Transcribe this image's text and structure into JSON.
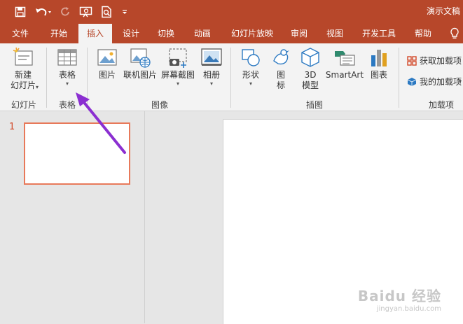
{
  "titlebar": {
    "title": "演示文稿",
    "qat": [
      "save-icon",
      "undo-icon",
      "redo-icon",
      "slideshow-from-start-icon",
      "print-preview-icon",
      "customize-qat-icon"
    ]
  },
  "tabs": [
    {
      "label": "文件",
      "active": false
    },
    {
      "label": "开始",
      "active": false
    },
    {
      "label": "插入",
      "active": true
    },
    {
      "label": "设计",
      "active": false
    },
    {
      "label": "切换",
      "active": false
    },
    {
      "label": "动画",
      "active": false
    },
    {
      "label": "幻灯片放映",
      "active": false
    },
    {
      "label": "审阅",
      "active": false
    },
    {
      "label": "视图",
      "active": false
    },
    {
      "label": "开发工具",
      "active": false
    },
    {
      "label": "帮助",
      "active": false
    }
  ],
  "ribbon": {
    "groups": {
      "slides": "幻灯片",
      "tables": "表格",
      "images": "图像",
      "illustrations": "插图",
      "addins": "加载项"
    },
    "buttons": {
      "new_slide_line1": "新建",
      "new_slide_line2": "幻灯片",
      "table": "表格",
      "pictures": "图片",
      "online_pictures": "联机图片",
      "screenshot": "屏幕截图",
      "album": "相册",
      "shapes": "形状",
      "icons_line1": "图",
      "icons_line2": "标",
      "model3d_line1": "3D",
      "model3d_line2": "模型",
      "smartart": "SmartArt",
      "chart": "图表",
      "get_addins": "获取加载项",
      "my_addins": "我的加载项"
    }
  },
  "slides_panel": {
    "slide_number": "1"
  },
  "watermark": {
    "main": "Baidu 经验",
    "sub": "jingyan.baidu.com"
  },
  "colors": {
    "brand": "#b7472a",
    "thumb_border": "#e8795a",
    "annotation_arrow": "#8b2fd1"
  }
}
